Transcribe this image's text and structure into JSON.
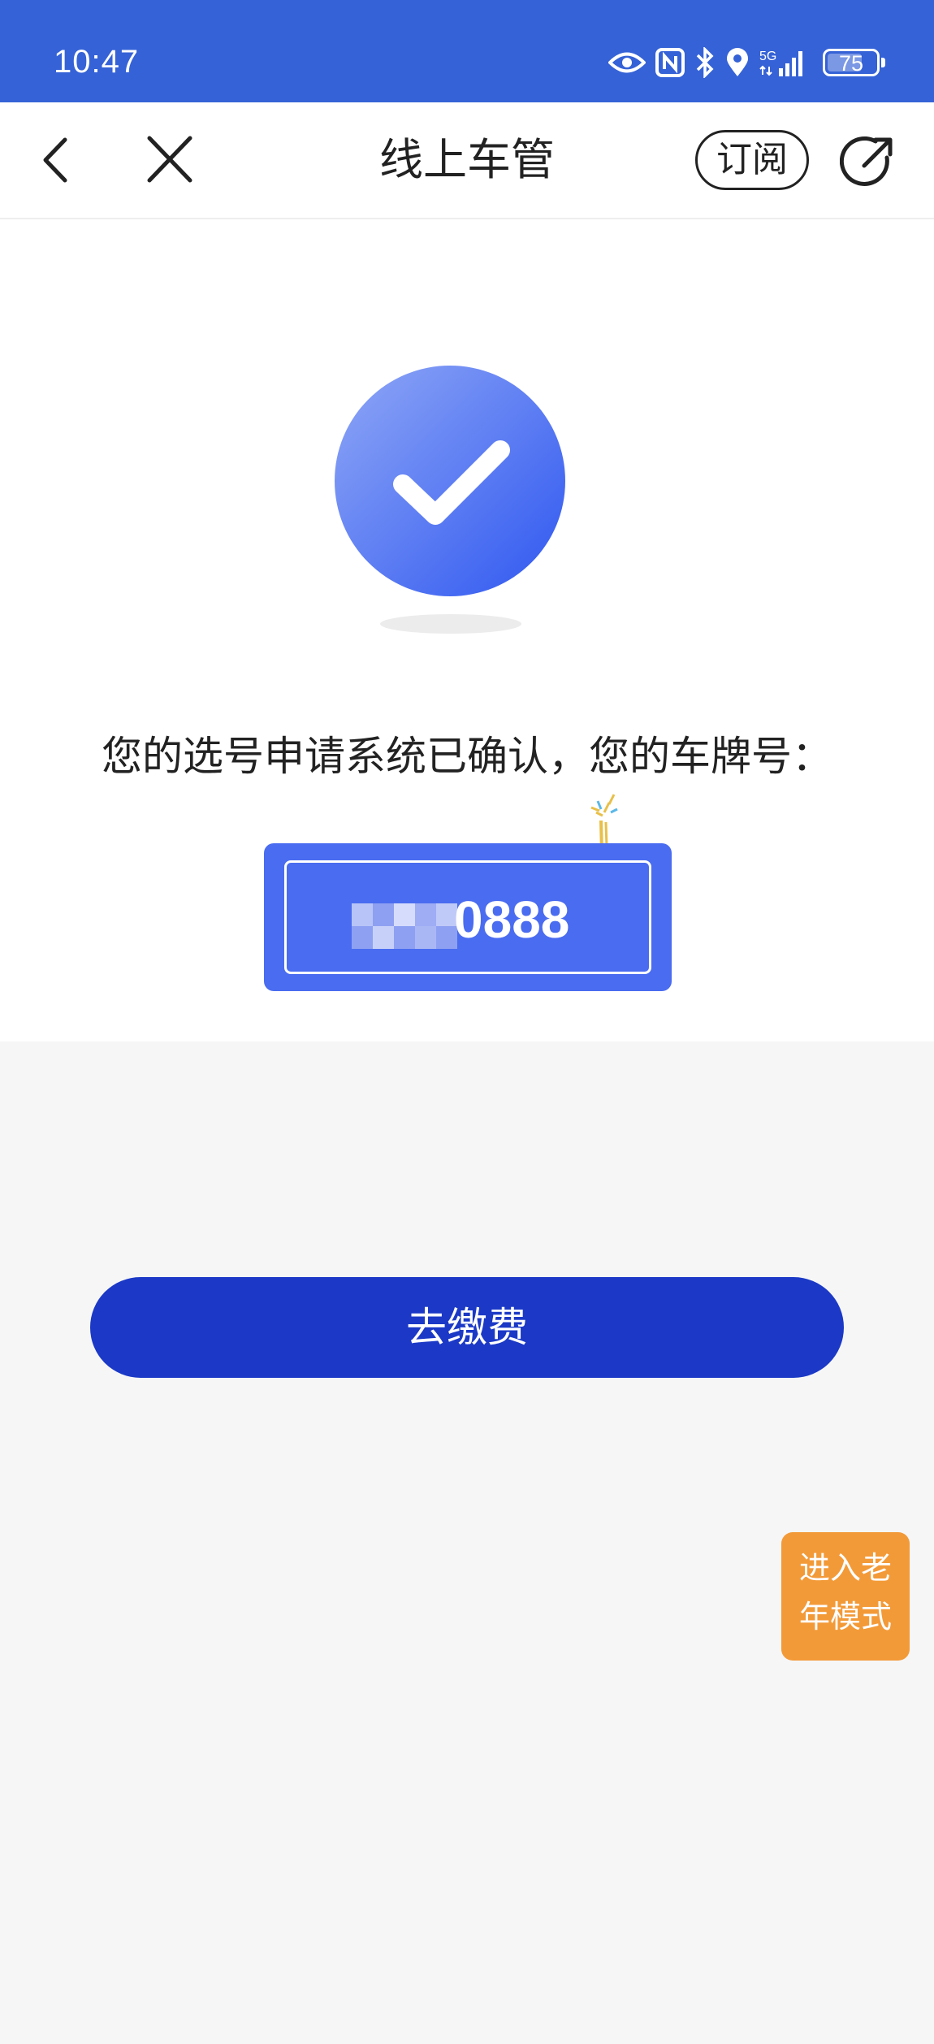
{
  "status_bar": {
    "time": "10:47",
    "network": "5G",
    "battery": "75",
    "battery_level": 0.75
  },
  "nav": {
    "title": "线上车管",
    "subscribe_label": "订阅"
  },
  "result": {
    "confirm_text": "您的选号申请系统已确认，您的车牌号：",
    "plate_number_visible": "0888"
  },
  "actions": {
    "pay_label": "去缴费",
    "elder_mode_line1": "进入老",
    "elder_mode_line2": "年模式"
  },
  "colors": {
    "status_bar": "#3562d6",
    "primary": "#1b39c6",
    "plate": "#4a6cf0",
    "elder_mode": "#f39a38"
  }
}
